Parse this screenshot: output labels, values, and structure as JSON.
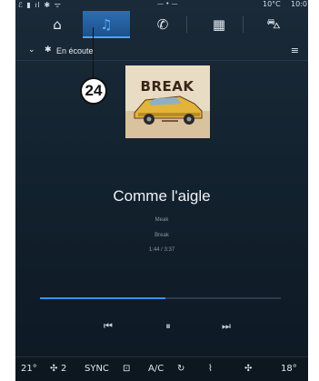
{
  "status_bar": {
    "indicators": "ℰ ▮ ıl ✱ ᯤ",
    "center": "— • —",
    "outside_temp": "10°C",
    "time": "10:07"
  },
  "nav": {
    "tabs": [
      {
        "name": "home",
        "icon": "house-icon",
        "glyph": "⌂",
        "active": false
      },
      {
        "name": "media",
        "icon": "music-note-icon",
        "glyph": "♫",
        "active": true
      },
      {
        "name": "phone",
        "icon": "phone-icon",
        "glyph": "✆",
        "active": false
      },
      {
        "name": "apps",
        "icon": "apps-grid-icon",
        "glyph": "▦",
        "active": false
      },
      {
        "name": "vehicle",
        "icon": "car-icon",
        "glyph": "⛍",
        "active": false
      }
    ]
  },
  "source_bar": {
    "label": "En écoute",
    "chevron_glyph": "⌄",
    "bluetooth_glyph": "✱",
    "queue_glyph": "≡"
  },
  "callout": {
    "number": "24"
  },
  "album_art": {
    "title": "BREAK"
  },
  "track": {
    "title": "Comme l'aigle",
    "artist": "Meak",
    "album": "Break",
    "time": "1:44 / 3:37",
    "progress": 0.52
  },
  "controls": {
    "prev_glyph": "⏮",
    "pause_glyph": "⏸",
    "next_glyph": "⏭"
  },
  "climate": {
    "driver_temp": "21°",
    "fan_level": "2",
    "fan_glyph": "✣",
    "sync_label": "SYNC",
    "defrost_glyph": "⊡",
    "ac_label": "A/C",
    "recirc_glyph": "↻",
    "seat_glyph": "⌇",
    "passenger_temp": "18°"
  },
  "colors": {
    "accent": "#3d8fe6",
    "active_tab": "#2b6eb3",
    "background": "#13222f"
  }
}
